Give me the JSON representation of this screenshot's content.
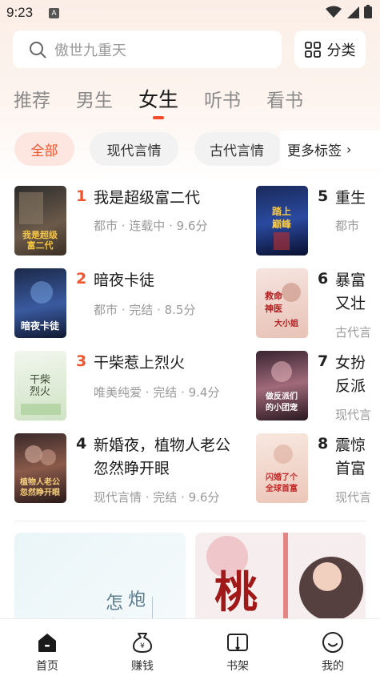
{
  "status_bar": {
    "time": "9:23",
    "notif_badge": "A"
  },
  "search": {
    "placeholder": "傲世九重天"
  },
  "category_button": {
    "label": "分类",
    "icon": "grid-icon"
  },
  "tabs": [
    {
      "label": "推荐",
      "active": false
    },
    {
      "label": "男生",
      "active": false
    },
    {
      "label": "女生",
      "active": true
    },
    {
      "label": "听书",
      "active": false
    },
    {
      "label": "看书",
      "active": false
    }
  ],
  "chips": [
    {
      "label": "全部",
      "active": true
    },
    {
      "label": "现代言情",
      "active": false
    },
    {
      "label": "古代言情",
      "active": false
    }
  ],
  "more_tags": {
    "label": "更多标签",
    "chevron": "›"
  },
  "rank_left": [
    {
      "rank": "1",
      "title_lines": [
        "我是超级富二代"
      ],
      "meta": "都市 · 连载中 · 9.6分",
      "cover_text": "我是超级富二代"
    },
    {
      "rank": "2",
      "title_lines": [
        "暗夜卡徒"
      ],
      "meta": "都市 · 完结 · 8.5分",
      "cover_text": "暗夜卡徒"
    },
    {
      "rank": "3",
      "title_lines": [
        "干柴惹上烈火"
      ],
      "meta": "唯美纯爱 · 完结 · 9.4分",
      "cover_text": "干柴烈火"
    },
    {
      "rank": "4",
      "title_lines": [
        "新婚夜，植物人老公",
        "忽然睁开眼"
      ],
      "meta": "现代言情 · 完结 · 9.6分",
      "cover_text": "植物人老公忽然睁开眼"
    }
  ],
  "rank_right": [
    {
      "rank": "5",
      "title_lines": [
        "重生"
      ],
      "meta": "都市",
      "cover_text": "踏上巅峰"
    },
    {
      "rank": "6",
      "title_lines": [
        "暴富",
        "又壮"
      ],
      "meta": "古代言",
      "cover_text": "救命神医大小姐"
    },
    {
      "rank": "7",
      "title_lines": [
        "女扮",
        "反派"
      ],
      "meta": "现代言",
      "cover_text": "做反派们的小团宠"
    },
    {
      "rank": "8",
      "title_lines": [
        "震惊",
        "首富"
      ],
      "meta": "现代言",
      "cover_text": "闪婚了个全球首富"
    }
  ],
  "banners": {
    "left_text": [
      "怎",
      "炮",
      "么"
    ],
    "right_text": "桃"
  },
  "bottom_nav": [
    {
      "label": "首页",
      "icon": "home-icon",
      "active": true
    },
    {
      "label": "赚钱",
      "icon": "money-bag-icon",
      "active": false
    },
    {
      "label": "书架",
      "icon": "bookshelf-icon",
      "active": false
    },
    {
      "label": "我的",
      "icon": "profile-icon",
      "active": false
    }
  ],
  "colors": {
    "accent": "#f2542d",
    "rank_top": "#f2542d",
    "rank_other": "#222222"
  }
}
